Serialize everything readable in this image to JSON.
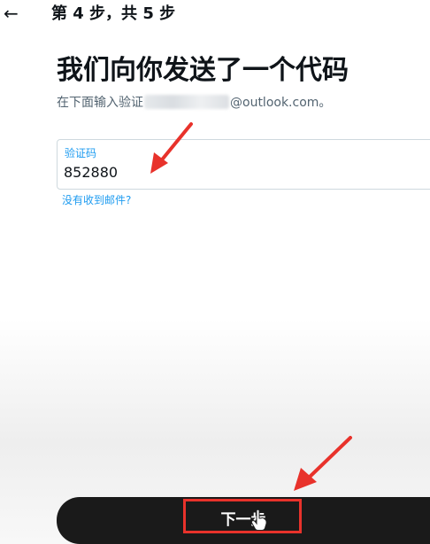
{
  "header": {
    "back_icon": "arrow-left-icon",
    "step_text": "第 4 步，共 5 步"
  },
  "main": {
    "title": "我们向你发送了一个代码",
    "subtitle_prefix": "在下面输入验证",
    "subtitle_suffix": "@outlook.com。",
    "code_field": {
      "label": "验证码",
      "value": "852880"
    },
    "resend_link": "没有收到邮件?"
  },
  "footer": {
    "next_label": "下一步"
  },
  "colors": {
    "accent": "#1d9bf0",
    "annotation": "#e8322b",
    "button": "#1a1a1a"
  }
}
